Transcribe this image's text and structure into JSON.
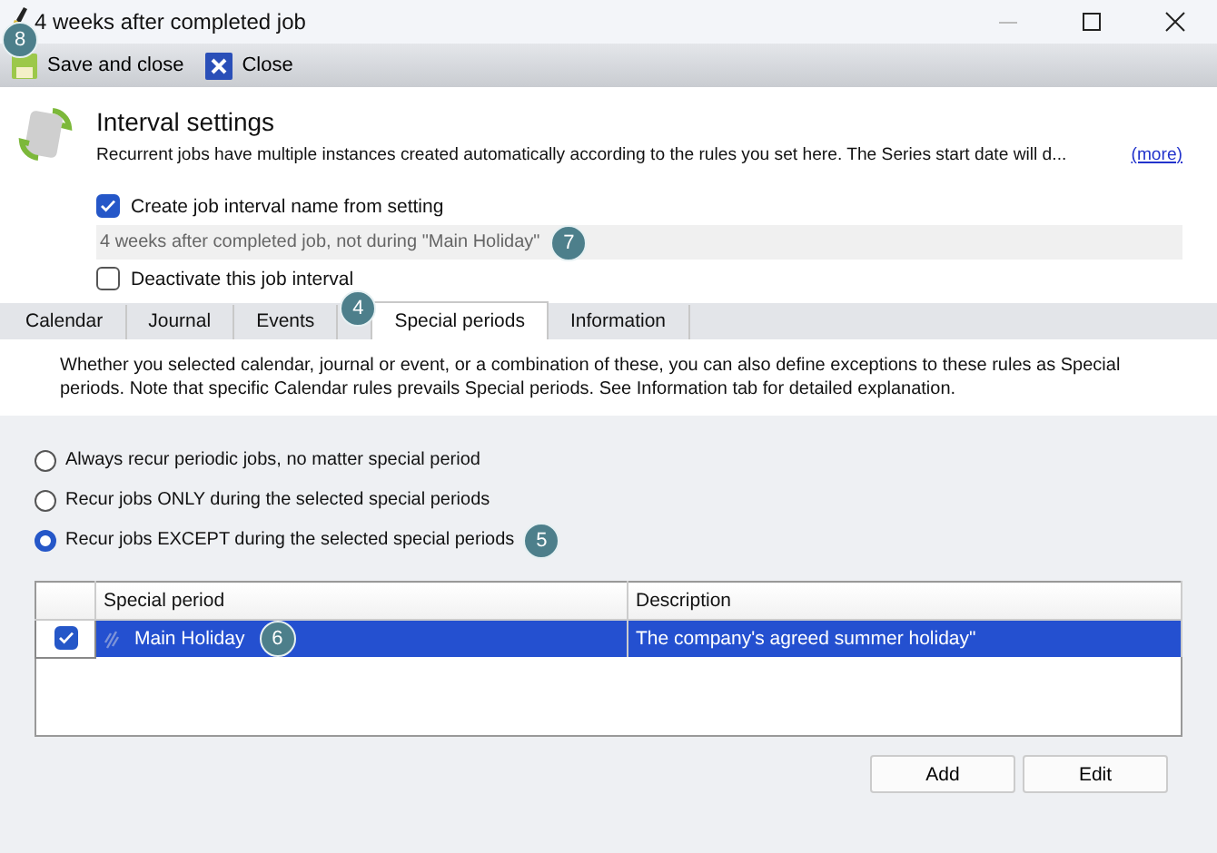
{
  "window": {
    "title": "4 weeks after completed job"
  },
  "toolbar": [
    {
      "label": "Save and close",
      "kind": "save",
      "callout": "8"
    },
    {
      "label": "Close",
      "kind": "close"
    }
  ],
  "header": {
    "title": "Interval settings",
    "description": "Recurrent jobs have multiple instances created automatically according to the rules you set here. The Series start date will d...",
    "more_link": "(more)"
  },
  "name_from_setting": {
    "label": "Create job interval name from setting",
    "checked": true
  },
  "interval_name": {
    "value": "4 weeks after completed job, not during \"Main Holiday\"",
    "callout": "7"
  },
  "deactivate": {
    "label": "Deactivate this job interval",
    "checked": false
  },
  "tabs": [
    {
      "label": "Calendar",
      "selected": false
    },
    {
      "label": "Journal",
      "selected": false
    },
    {
      "label": "Events",
      "selected": false
    },
    {
      "label": "Special periods",
      "selected": true,
      "callout": "4"
    },
    {
      "label": "Information",
      "selected": false
    }
  ],
  "info_text": "Whether you selected calendar, journal or event, or a combination of these, you can also define exceptions to these rules as Special periods. Note that specific Calendar rules prevails Special periods. See Information tab for detailed explanation.",
  "recurrence_options": [
    {
      "label": "Always recur periodic jobs, no matter special period",
      "selected": false
    },
    {
      "label": "Recur jobs ONLY during the selected special periods",
      "selected": false
    },
    {
      "label": "Recur jobs EXCEPT during the selected special periods",
      "selected": true,
      "callout": "5"
    }
  ],
  "table": {
    "columns": [
      "Special period",
      "Description"
    ],
    "rows": [
      {
        "checked": true,
        "selected": true,
        "special_period": "Main Holiday",
        "description": "The company's agreed summer holiday\"",
        "callout": "6"
      }
    ]
  },
  "buttons": [
    "Add",
    "Edit"
  ]
}
